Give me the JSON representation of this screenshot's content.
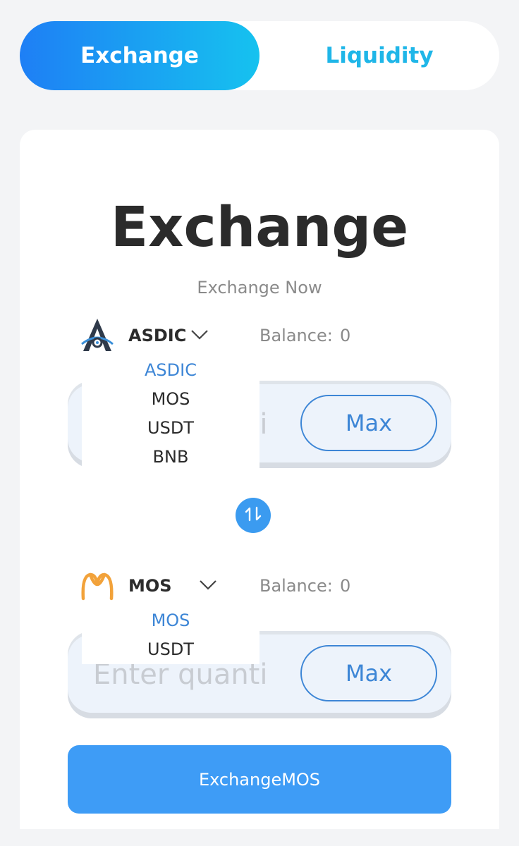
{
  "tabs": [
    {
      "label": "Exchange",
      "active": true
    },
    {
      "label": "Liquidity",
      "active": false
    }
  ],
  "card": {
    "title": "Exchange",
    "subtitle": "Exchange Now"
  },
  "from": {
    "token": "ASDIC",
    "icon": "asdic-logo-icon",
    "balance_label": "Balance:",
    "balance_value": "0",
    "input_placeholder": "Enter quanti",
    "max_label": "Max",
    "dropdown_options": [
      "ASDIC",
      "MOS",
      "USDT",
      "BNB"
    ],
    "selected": "ASDIC"
  },
  "to": {
    "token": "MOS",
    "icon": "mos-logo-icon",
    "balance_label": "Balance:",
    "balance_value": "0",
    "input_placeholder": "Enter quanti",
    "max_label": "Max",
    "dropdown_options": [
      "MOS",
      "USDT"
    ],
    "selected": "MOS"
  },
  "action": {
    "label": "ExchangeMOS"
  },
  "colors": {
    "accent": "#3e9cf6",
    "tab_gradient_start": "#1e7ff5",
    "tab_gradient_end": "#16c2ef",
    "liquidity_text": "#1fb6e8",
    "selected_option": "#3d86d6",
    "mos_orange": "#f2a23a"
  }
}
